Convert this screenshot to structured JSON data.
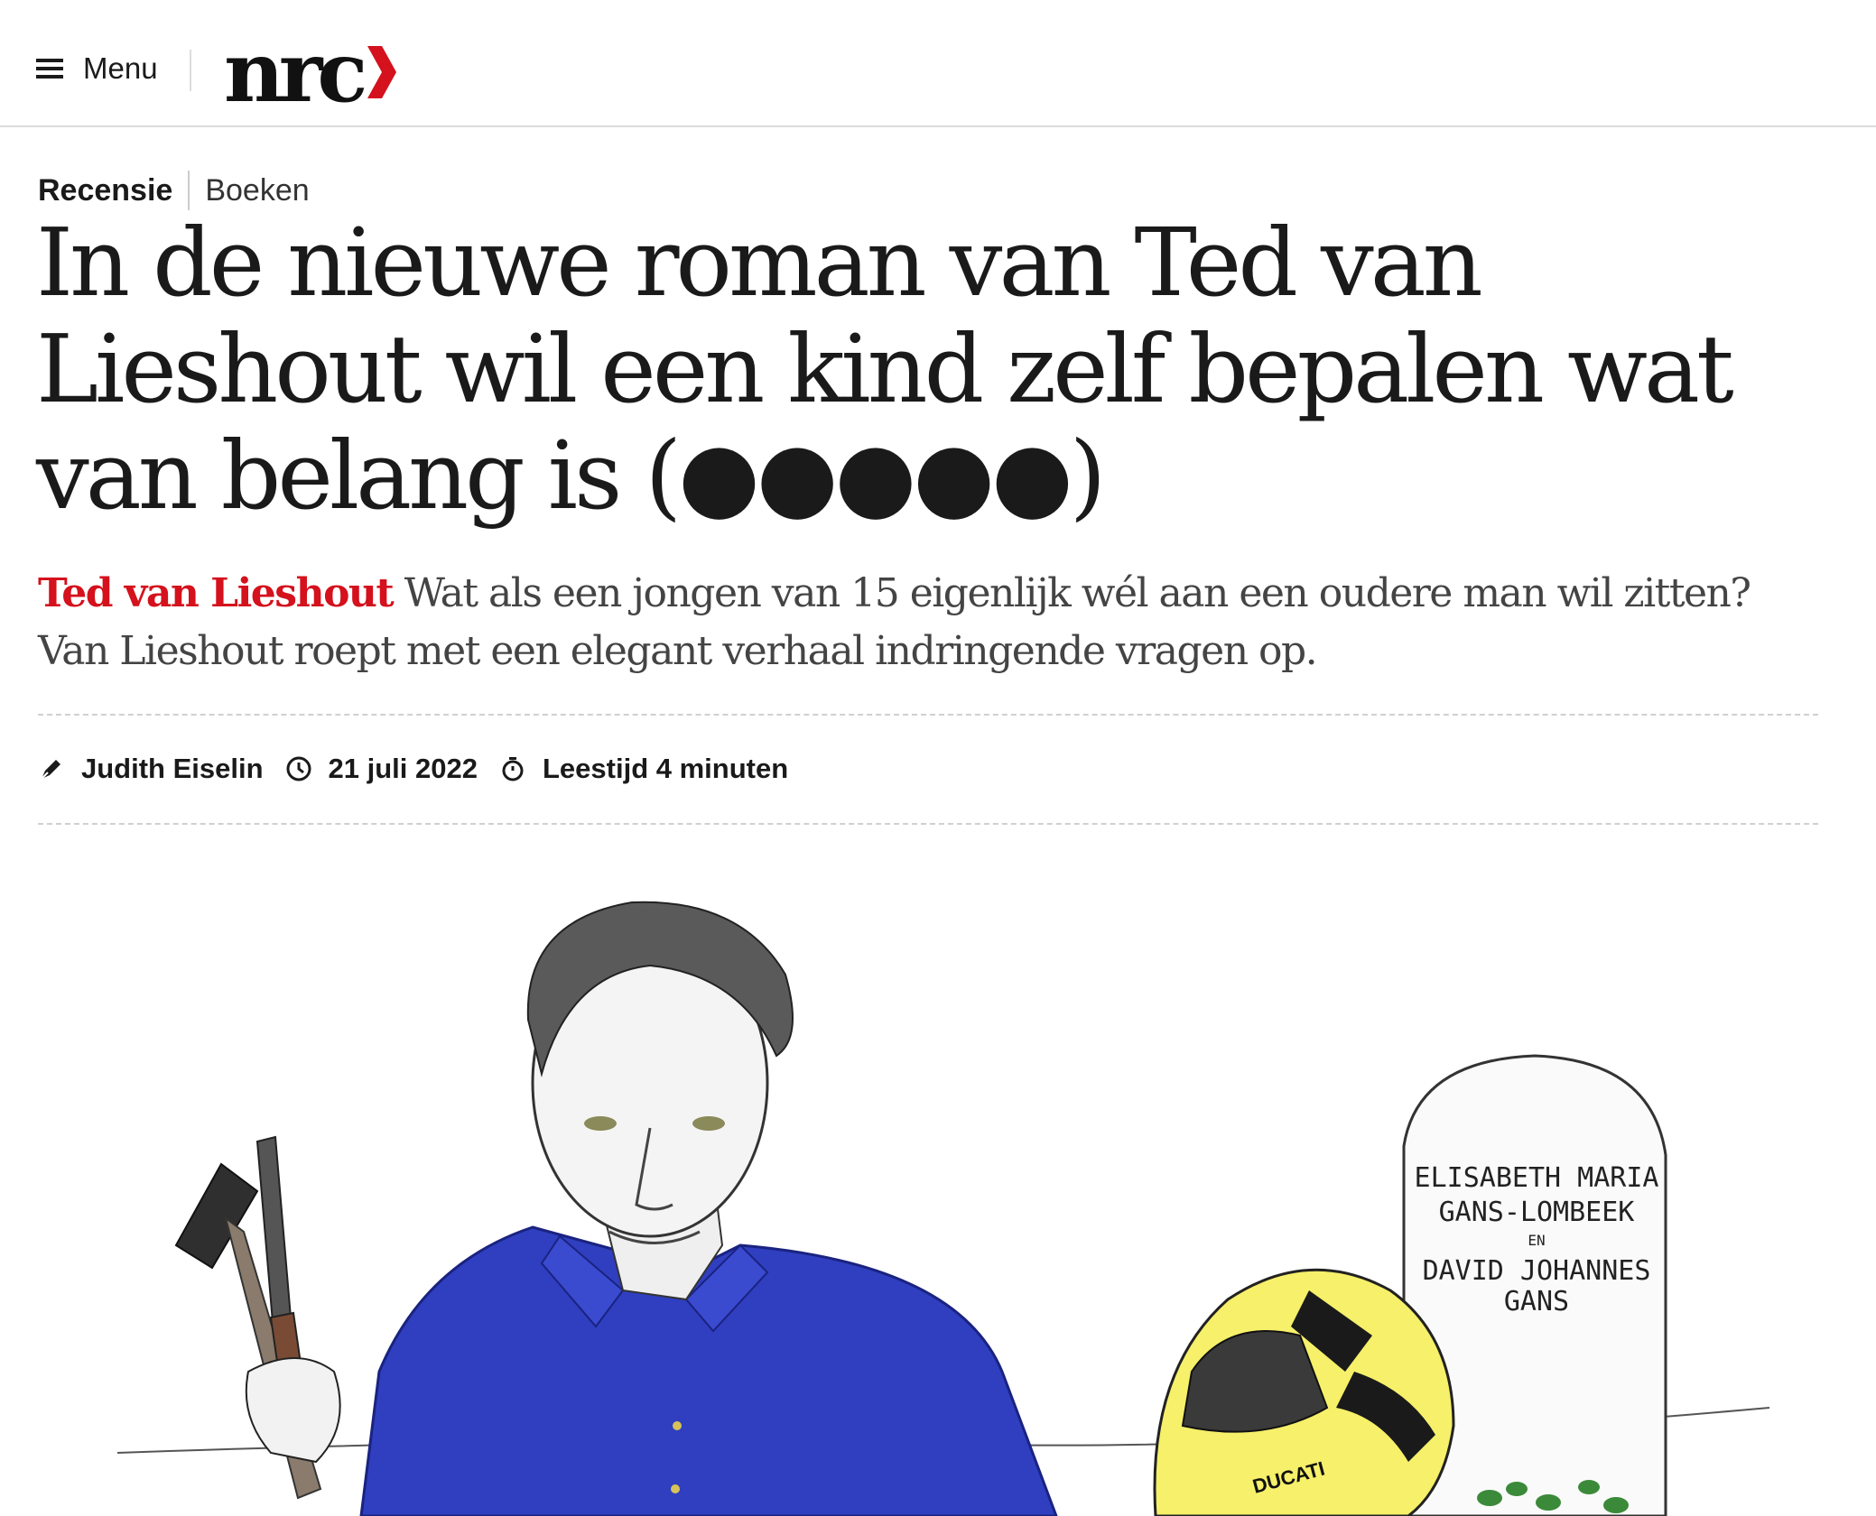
{
  "header": {
    "menu_label": "Menu",
    "logo_text": "nrc",
    "brand_color": "#d4111c"
  },
  "article": {
    "kicker": "Recensie",
    "category": "Boeken",
    "headline": "In de nieuwe roman van Ted van Lieshout wil een kind zelf bepalen wat van belang is (●●●●●)",
    "intro_subject": "Ted van Lieshout",
    "intro_text": "Wat als een jongen van 15 eigenlijk wél aan een oudere man wil zitten? Van Lieshout roept met een elegant verhaal indringende vragen op.",
    "author": "Judith Eiselin",
    "date": "21 juli 2022",
    "reading_time": "Leestijd 4 minuten"
  },
  "illustration": {
    "tombstone_lines": [
      "ELISABETH MARIA",
      "GANS-LOMBEEK",
      "EN",
      "DAVID JOHANNES",
      "GANS"
    ],
    "helmet_brand": "DUCATI"
  },
  "icons": {
    "menu": "hamburger-icon",
    "author": "pen-icon",
    "date": "clock-icon",
    "reading_time": "stopwatch-icon"
  }
}
